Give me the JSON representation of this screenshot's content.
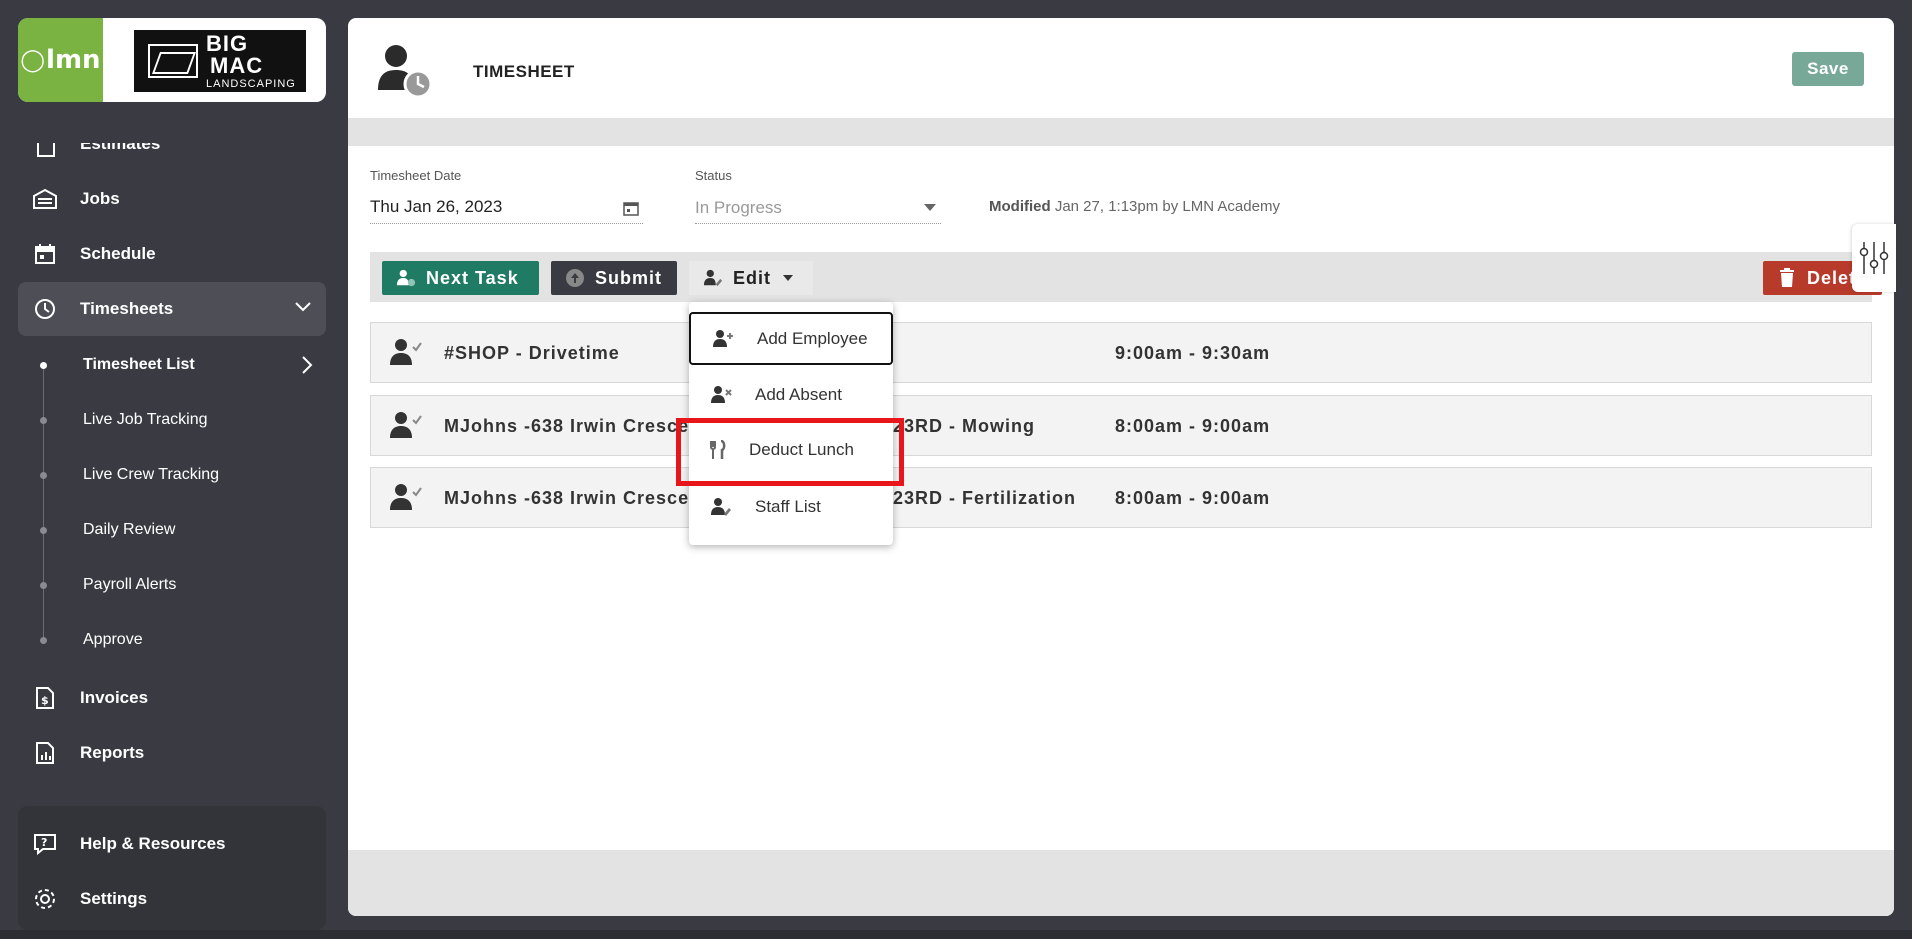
{
  "sidebar": {
    "brand": {
      "lmn": "lmn",
      "company_line1": "BIG",
      "company_line2": "MAC",
      "company_line3": "LANDSCAPING"
    },
    "partial_item": "Estimates",
    "items": {
      "jobs": "Jobs",
      "schedule": "Schedule",
      "timesheets": "Timesheets",
      "invoices": "Invoices",
      "reports": "Reports"
    },
    "timesheet_sub": [
      "Timesheet List",
      "Live Job Tracking",
      "Live Crew Tracking",
      "Daily Review",
      "Payroll Alerts",
      "Approve"
    ],
    "footer": {
      "help": "Help & Resources",
      "settings": "Settings"
    }
  },
  "header": {
    "title": "TIMESHEET",
    "save_label": "Save"
  },
  "form": {
    "date_label": "Timesheet Date",
    "date_value": "Thu Jan 26, 2023",
    "status_label": "Status",
    "status_value": "In Progress",
    "modified_label": "Modified",
    "modified_value": "Jan 27, 1:13pm by LMN Academy"
  },
  "toolbar": {
    "next_task": "Next Task",
    "submit": "Submit",
    "edit": "Edit",
    "delete": "Delete"
  },
  "tasks": [
    {
      "name": "#SHOP - Drivetime",
      "service": "",
      "time": "9:00am - 9:30am"
    },
    {
      "name": "MJohns -638 Irwin Cresce",
      "service": "23RD - Mowing",
      "time": "8:00am - 9:00am"
    },
    {
      "name": "MJohns -638 Irwin Cresce",
      "service": "23RD - Fertilization",
      "time": "8:00am - 9:00am"
    }
  ],
  "edit_menu": {
    "add_employee": "Add Employee",
    "add_absent": "Add Absent",
    "deduct_lunch": "Deduct Lunch",
    "staff_list": "Staff List"
  },
  "colors": {
    "sidebar_bg": "#3a3b42",
    "lmn_green": "#7bb342",
    "next_task_green": "#1f7b63",
    "delete_red": "#b83a2a",
    "save_teal": "#78a898",
    "highlight_red": "#e8151b"
  }
}
